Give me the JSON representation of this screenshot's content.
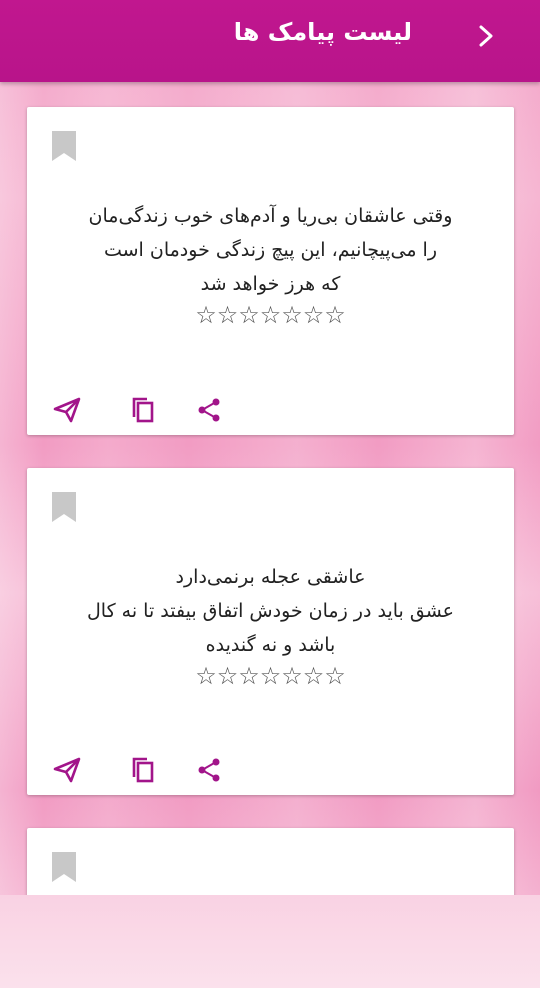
{
  "header": {
    "title": "لیست پیامک ها",
    "back_icon": "chevron-right-icon"
  },
  "colors": {
    "accent": "#b8148a",
    "icon": "#a2158a",
    "bookmark": "#c8c8c8"
  },
  "cards": [
    {
      "lines": [
        "وقتی عاشقان بی‌ریا و آدم‌های خوب زندگی‌مان",
        "را می‌پیچانیم، این پیچ زندگی خودمان است",
        "که هرز خواهد شد"
      ],
      "rating": "☆☆☆☆☆☆☆"
    },
    {
      "lines": [
        "عاشقی عجله برنمی‌دارد",
        "عشق باید در زمان خودش اتفاق بیفتد تا نه کال",
        "باشد و نه گندیده"
      ],
      "rating": "☆☆☆☆☆☆☆"
    },
    {
      "lines": [],
      "rating": ""
    }
  ]
}
